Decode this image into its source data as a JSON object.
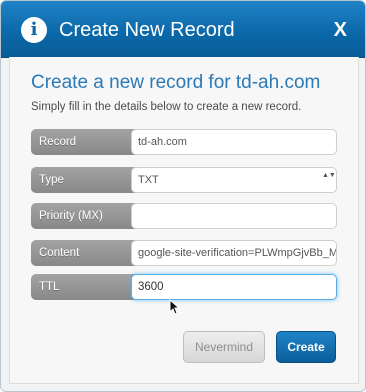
{
  "dialog": {
    "title": "Create New Record",
    "close_label": "X",
    "info_glyph": "i"
  },
  "form": {
    "heading": "Create a new record for td-ah.com",
    "subheading": "Simply fill in the details below to create a new record.",
    "fields": [
      {
        "label": "Record",
        "value": "td-ah.com"
      },
      {
        "label": "Type",
        "value": "TXT",
        "arrows": "▲▼"
      },
      {
        "label": "Priority (MX)",
        "value": ""
      },
      {
        "label": "Content",
        "value": "google-site-verification=PLWmpGjvBb_MMi"
      },
      {
        "label": "TTL",
        "value": "3600"
      }
    ]
  },
  "buttons": {
    "nevermind": "Nevermind",
    "create": "Create"
  },
  "colors": {
    "accent": "#0b67a7",
    "heading": "#2a7ab8",
    "label_bg": "#999999",
    "focus": "#5aaee8"
  }
}
